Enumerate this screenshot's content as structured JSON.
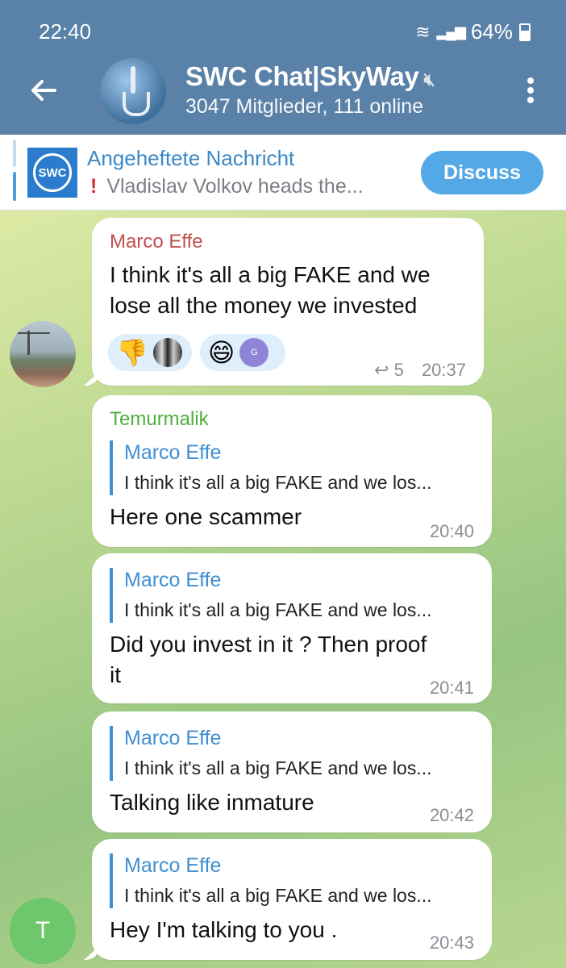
{
  "status_bar": {
    "time": "22:40",
    "battery": "64%",
    "wifi_icon": "wifi-icon",
    "signal_icon": "signal-icon"
  },
  "header": {
    "title": "SWC Chat|SkyWay",
    "subtitle": "3047 Mitglieder, 111 online",
    "back_icon": "arrow-left-icon",
    "mute_icon": "mute-icon",
    "menu_icon": "more-vertical-icon"
  },
  "pinned": {
    "title": "Angeheftete Nachricht",
    "excl": "!",
    "text": "Vladislav Volkov heads the...",
    "logo_text": "SWC",
    "discuss_label": "Discuss"
  },
  "messages": [
    {
      "sender": "Marco Effe",
      "sender_color": "#c0504d",
      "line1": "I think it's all a big FAKE and we",
      "line2": "lose all the money we invested",
      "reactions": [
        "👎",
        "😄"
      ],
      "reaction_avatar_letter": "G",
      "replies": "5",
      "time": "20:37"
    },
    {
      "sender": "Temurmalik",
      "sender_color": "#4fae3c",
      "quote_name": "Marco Effe",
      "quote_text": "I think it's all a big FAKE and we los...",
      "text": "Here one scammer",
      "time": "20:40"
    },
    {
      "quote_name": "Marco Effe",
      "quote_text": "I think it's all a big FAKE and we los...",
      "line1": "Did you invest in it ? Then proof",
      "line2": "it",
      "time": "20:41"
    },
    {
      "quote_name": "Marco Effe",
      "quote_text": "I think it's all a big FAKE and we los...",
      "text": "Talking like inmature",
      "time": "20:42"
    },
    {
      "quote_name": "Marco Effe",
      "quote_text": "I think it's all a big FAKE and we los...",
      "text": "Hey I'm talking to you .",
      "time": "20:43"
    }
  ],
  "avatar_t_letter": "T",
  "colors": {
    "header": "#5a81a8",
    "accent": "#3f8fd2",
    "discuss": "#55a8e6"
  }
}
